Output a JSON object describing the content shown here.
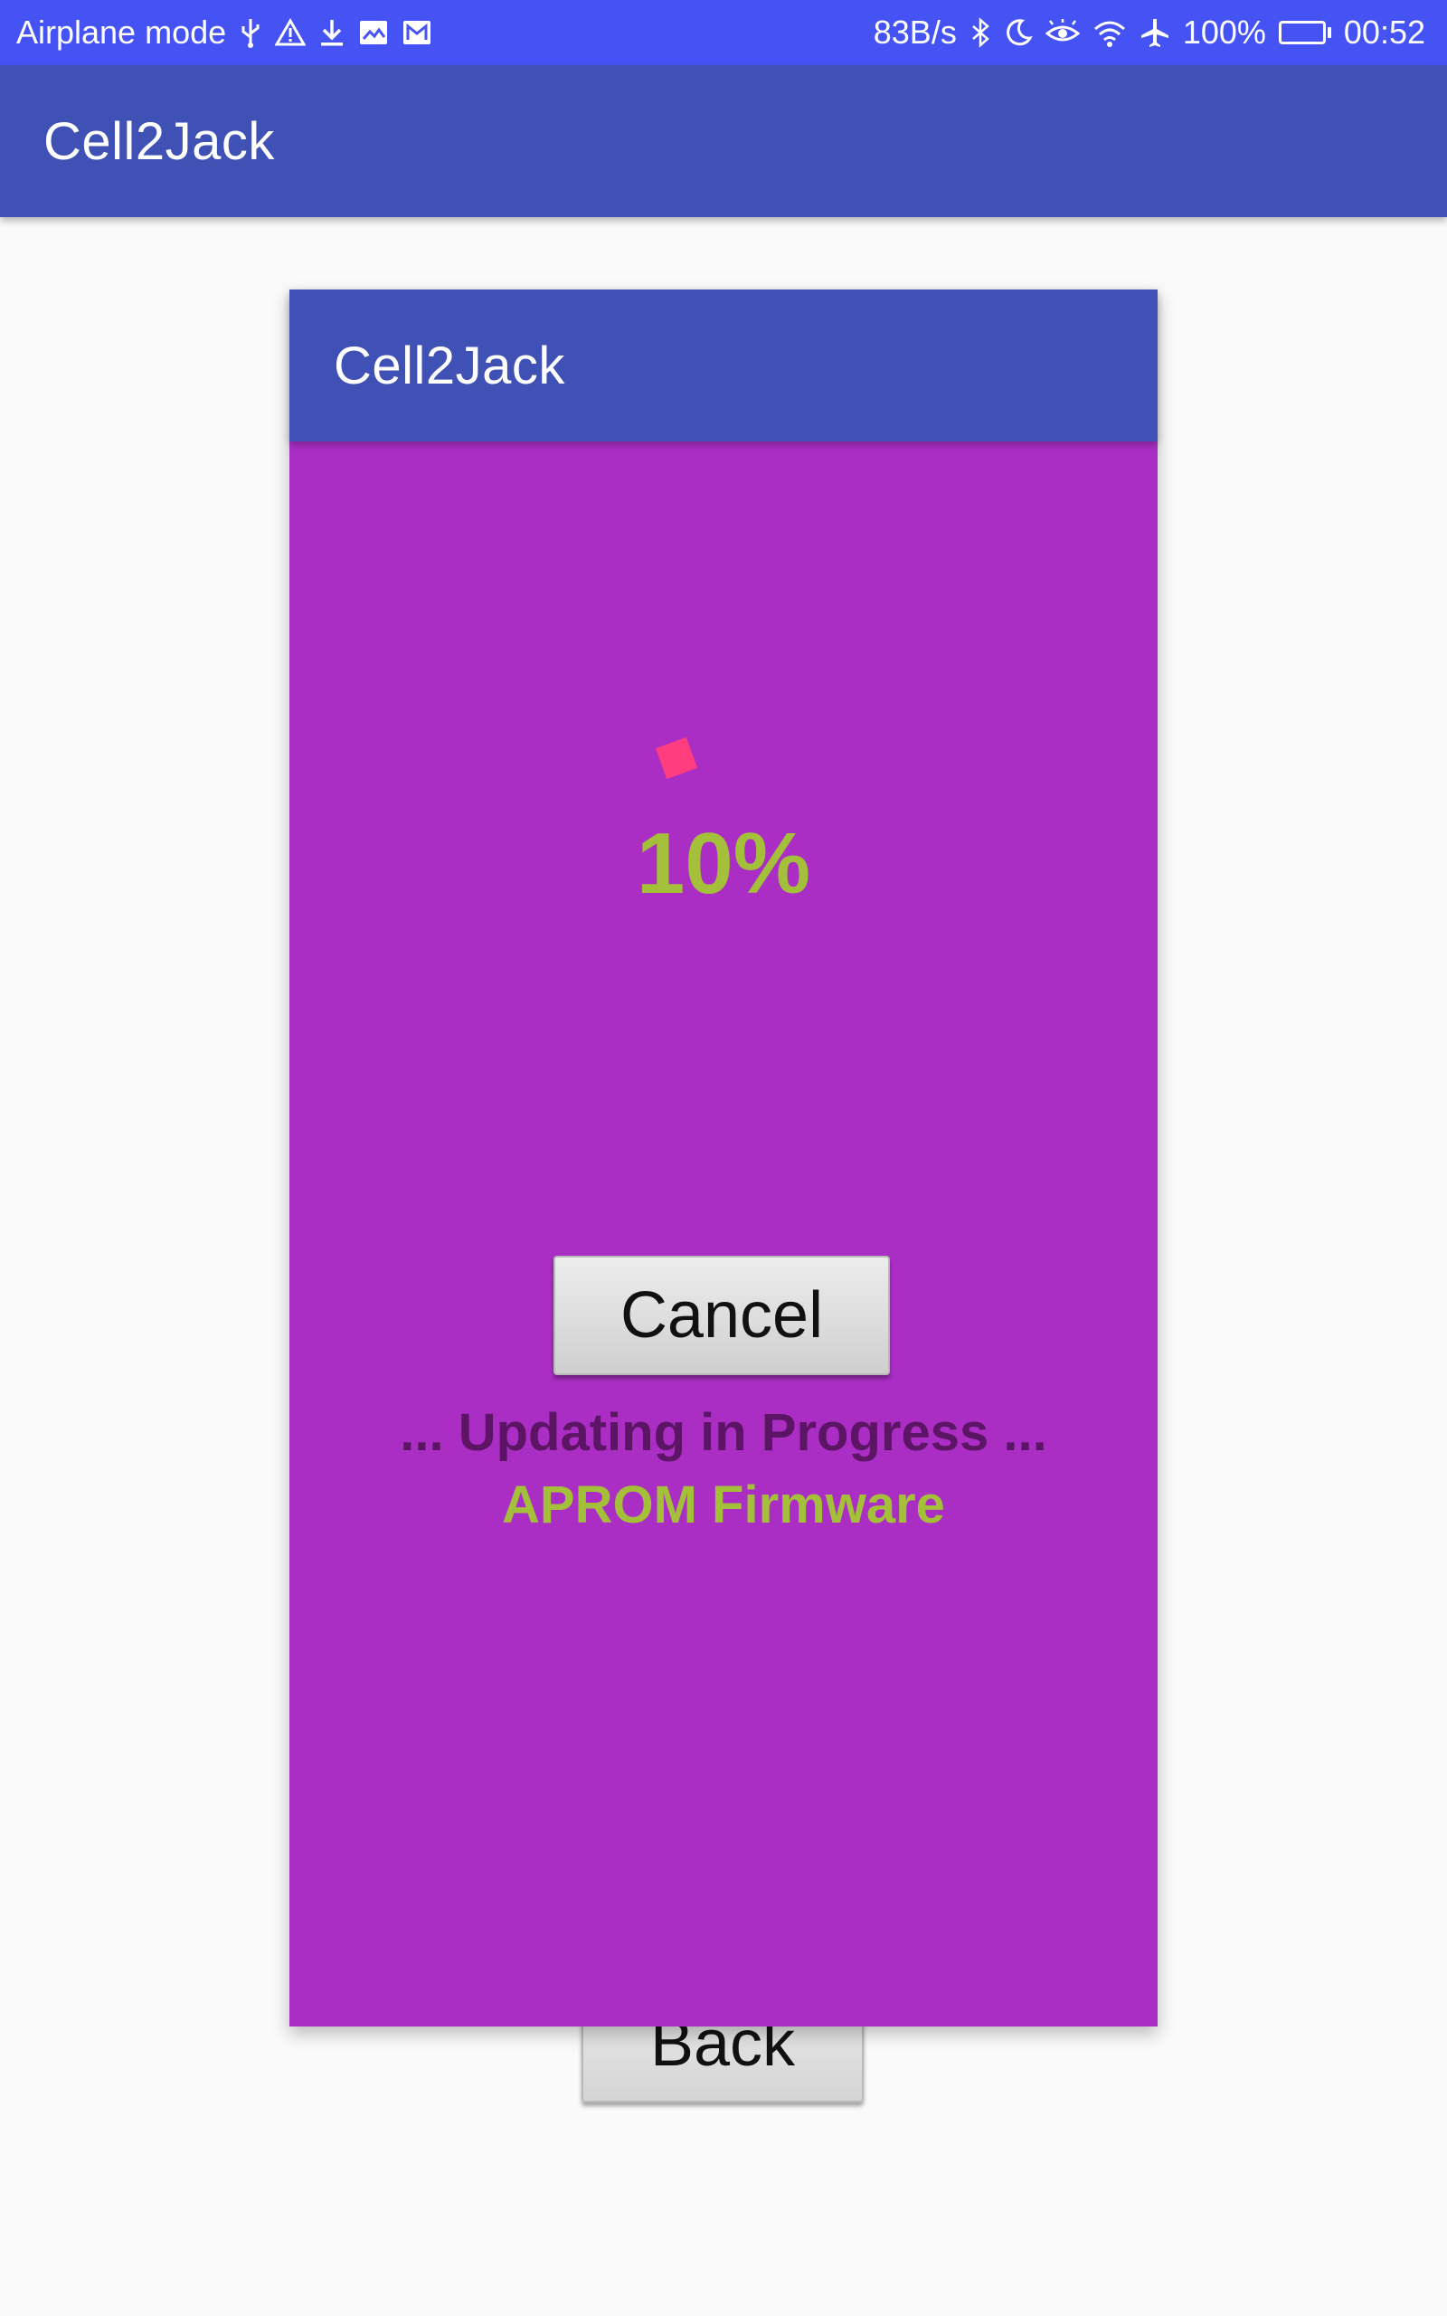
{
  "status_bar": {
    "left_text": "Airplane mode",
    "left_icons": [
      "usb-icon",
      "warning-icon",
      "download-icon",
      "image-icon",
      "gmail-icon"
    ],
    "network_speed": "83B/s",
    "right_icons": [
      "bluetooth-icon",
      "moon-icon",
      "eye-icon",
      "wifi-icon",
      "airplane-icon"
    ],
    "battery_percent": "100%",
    "battery_level": 1.0,
    "time": "00:52"
  },
  "app_bar": {
    "title": "Cell2Jack"
  },
  "dialog": {
    "title": "Cell2Jack",
    "progress_percent": "10%",
    "status_text": "... Updating in Progress ...",
    "firmware_text": "APROM Firmware",
    "cancel_label": "Cancel"
  },
  "back_button": {
    "label": "Back"
  },
  "colors": {
    "status_bar": "#4553f5",
    "app_bar": "#3f51b5",
    "dialog_background": "#aa2ec4",
    "accent_green": "#a4c03a",
    "status_text": "#5c1565",
    "spinner": "#ff3d7f"
  }
}
